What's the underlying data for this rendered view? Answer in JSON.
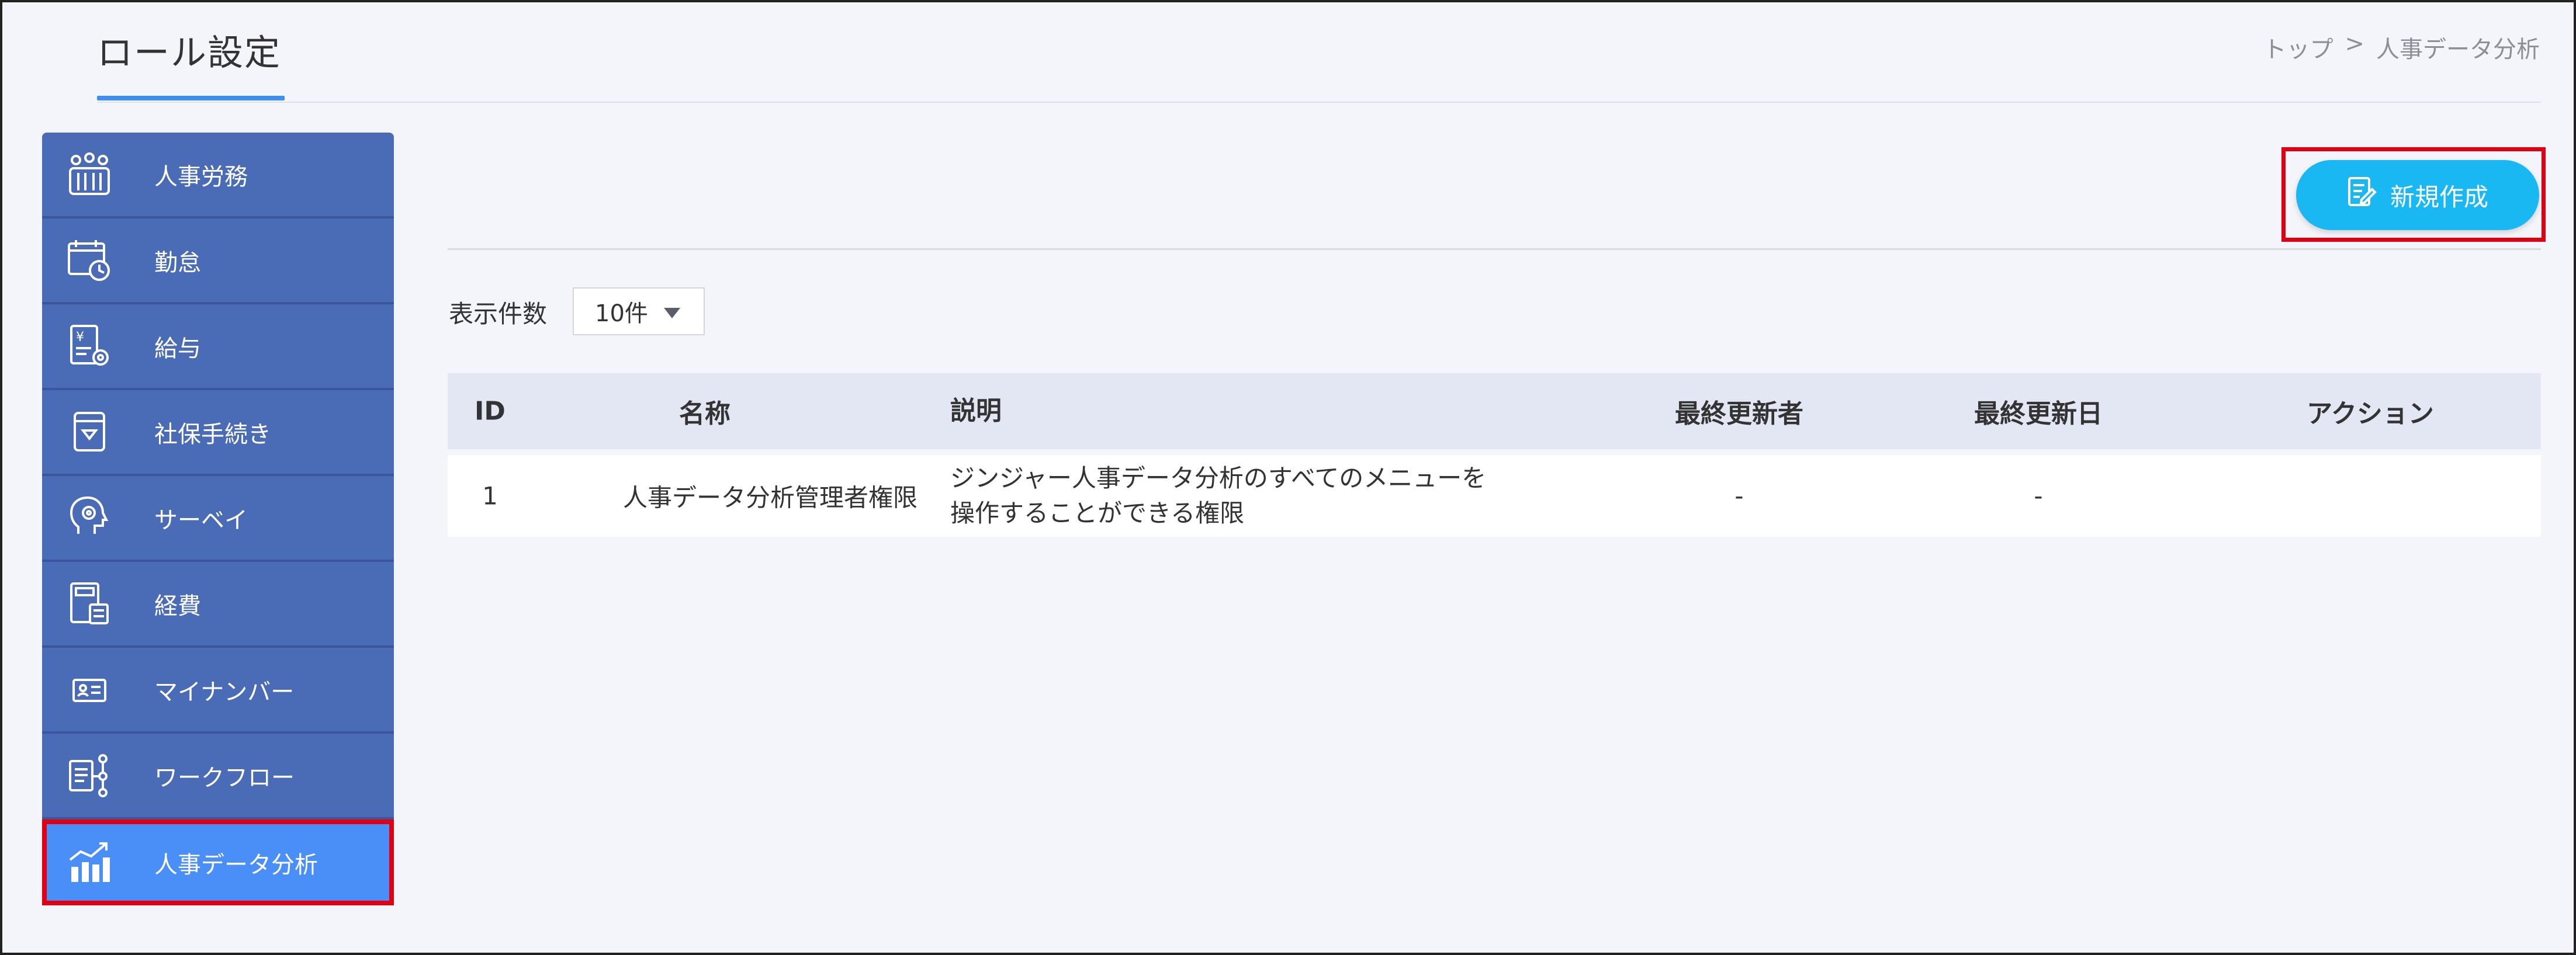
{
  "header": {
    "title": "ロール設定",
    "breadcrumb": {
      "home": "トップ",
      "separator": ">",
      "current": "人事データ分析"
    }
  },
  "sidebar": {
    "items": [
      {
        "label": "人事労務",
        "icon": "people-group-icon"
      },
      {
        "label": "勤怠",
        "icon": "calendar-clock-icon"
      },
      {
        "label": "給与",
        "icon": "payroll-gear-icon"
      },
      {
        "label": "社保手続き",
        "icon": "document-box-icon"
      },
      {
        "label": "サーベイ",
        "icon": "head-survey-icon"
      },
      {
        "label": "経費",
        "icon": "calculator-receipt-icon"
      },
      {
        "label": "マイナンバー",
        "icon": "id-card-icon"
      },
      {
        "label": "ワークフロー",
        "icon": "workflow-icon"
      },
      {
        "label": "人事データ分析",
        "icon": "bar-chart-trend-icon",
        "active": true
      }
    ]
  },
  "toolbar": {
    "new_label": "新規作成"
  },
  "list": {
    "show_label": "表示件数",
    "page_size": "10件"
  },
  "table": {
    "columns": {
      "id": "ID",
      "name": "名称",
      "description": "説明",
      "updated_by": "最終更新者",
      "updated_at": "最終更新日",
      "action": "アクション"
    },
    "rows": [
      {
        "id": "1",
        "name": "人事データ分析管理者権限",
        "description_line1": "ジンジャー人事データ分析のすべてのメニューを",
        "description_line2": "操作することができる権限",
        "updated_by": "-",
        "updated_at": "-",
        "action": ""
      }
    ]
  },
  "colors": {
    "sidebar_bg": "#4a6bb5",
    "sidebar_active": "#4a8ef7",
    "button": "#1ab8f2",
    "highlight": "#e00012"
  }
}
